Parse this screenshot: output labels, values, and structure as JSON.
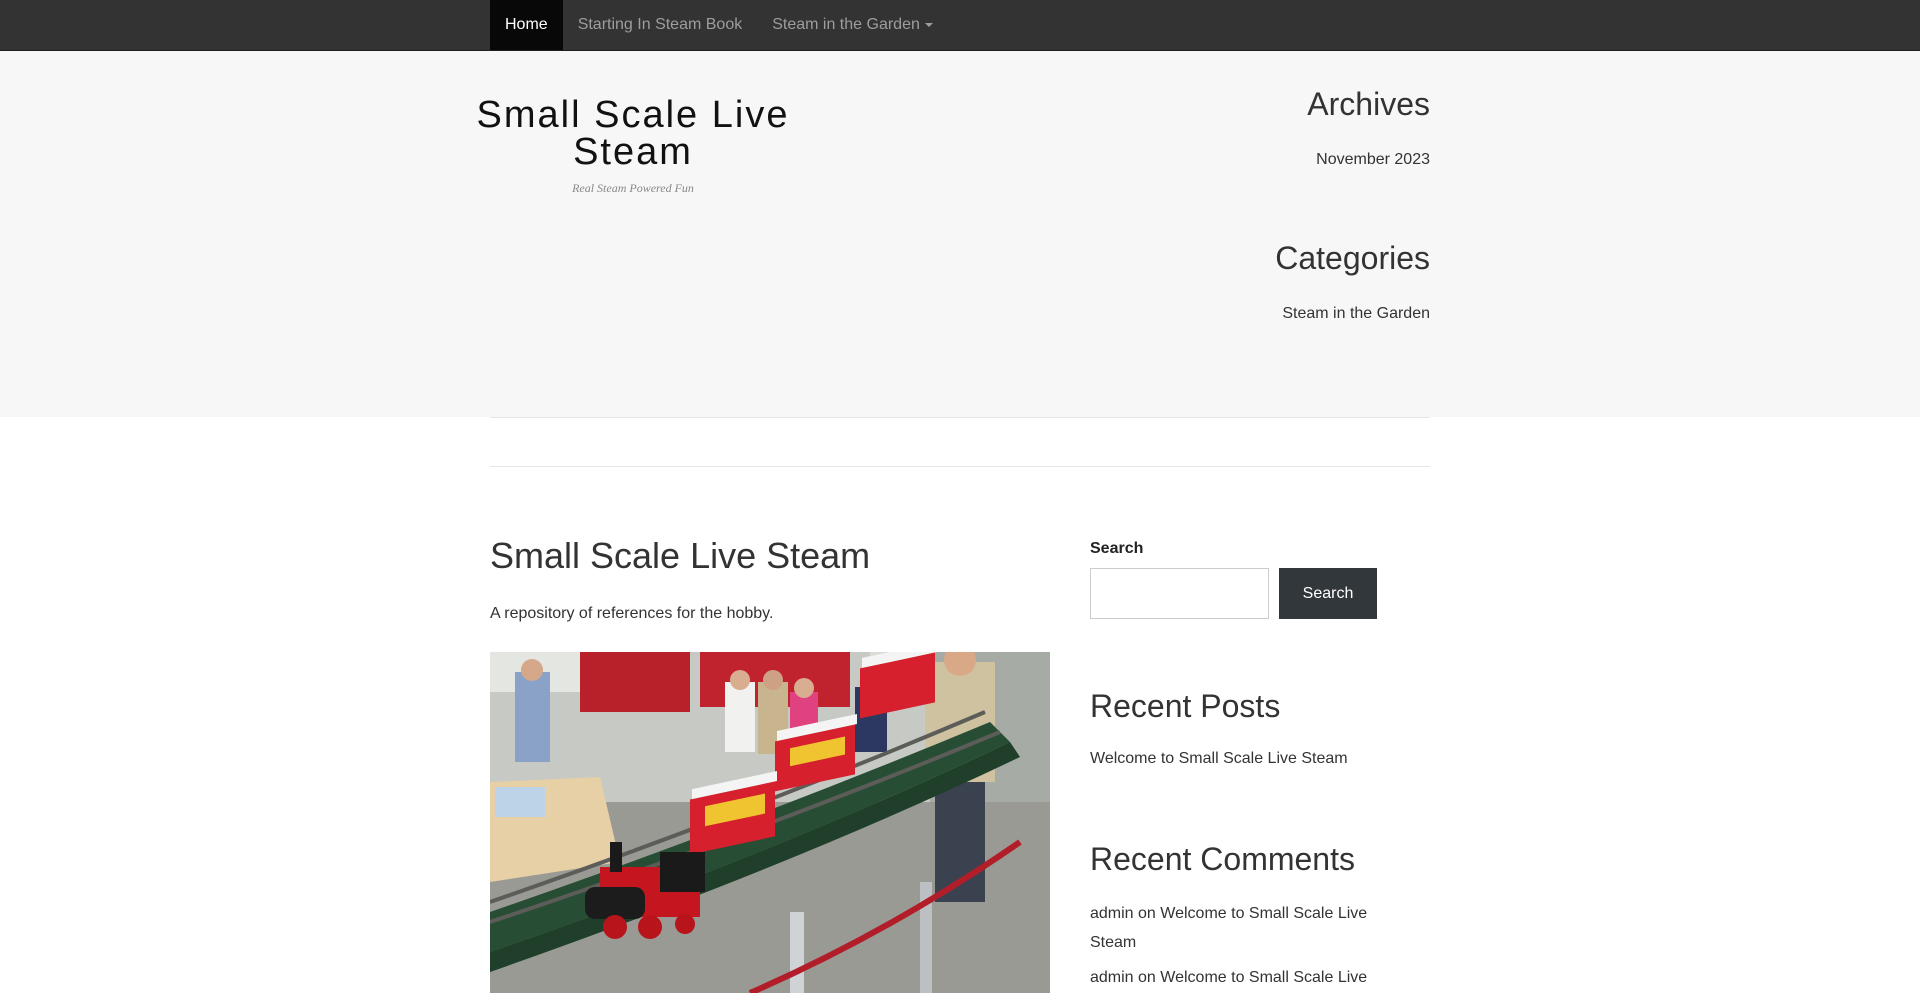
{
  "nav": {
    "items": [
      {
        "label": "Home",
        "active": true
      },
      {
        "label": "Starting In Steam Book",
        "active": false
      },
      {
        "label": "Steam in the Garden",
        "active": false,
        "dropdown": true
      }
    ]
  },
  "site": {
    "title": "Small Scale Live Steam",
    "description": "Real Steam Powered Fun"
  },
  "header_widgets": {
    "archives_title": "Archives",
    "archives_link": "November 2023",
    "categories_title": "Categories",
    "categories_link": "Steam in the Garden"
  },
  "page": {
    "title": "Small Scale Live Steam",
    "text": "A repository of references for the hobby."
  },
  "sidebar": {
    "search": {
      "label": "Search",
      "value": "",
      "placeholder": "",
      "button": "Search"
    },
    "recent_posts_title": "Recent Posts",
    "recent_posts": [
      "Welcome to Small Scale Live Steam"
    ],
    "recent_comments_title": "Recent Comments",
    "recent_comments": [
      {
        "author": "admin",
        "on": "on",
        "post": "Welcome to Small Scale Live Steam"
      },
      {
        "author": "admin",
        "on": "on",
        "post": "Welcome to Small Scale Live"
      }
    ]
  },
  "colors": {
    "navbar": "#333333",
    "nav_active": "#080808",
    "header_band": "#f7f7f7",
    "search_button": "#32373c"
  }
}
